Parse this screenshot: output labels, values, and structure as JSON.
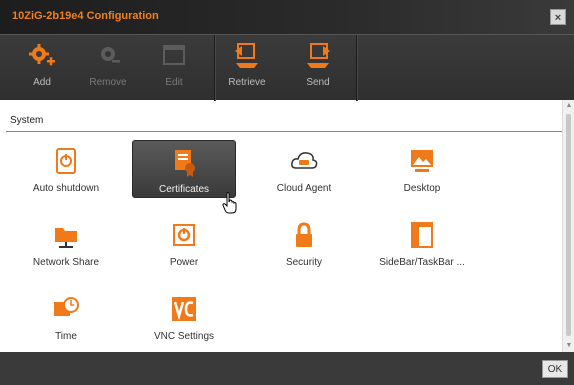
{
  "window": {
    "title": "10ZiG-2b19e4 Configuration",
    "close_glyph": "×"
  },
  "toolbar": {
    "buttons": [
      {
        "label": "Add",
        "icon": "add-gear-icon",
        "enabled": true
      },
      {
        "label": "Remove",
        "icon": "remove-gear-icon",
        "enabled": false
      },
      {
        "label": "Edit",
        "icon": "edit-window-icon",
        "enabled": false
      },
      {
        "label": "Retrieve",
        "icon": "retrieve-icon",
        "enabled": true
      },
      {
        "label": "Send",
        "icon": "send-icon",
        "enabled": true
      }
    ]
  },
  "section": {
    "title": "System"
  },
  "items": [
    {
      "label": "Auto shutdown",
      "icon": "auto-shutdown-icon"
    },
    {
      "label": "Certificates",
      "icon": "certificates-icon",
      "selected": true
    },
    {
      "label": "Cloud Agent",
      "icon": "cloud-agent-icon"
    },
    {
      "label": "Desktop",
      "icon": "desktop-icon"
    },
    {
      "label": "Network Share",
      "icon": "network-share-icon"
    },
    {
      "label": "Power",
      "icon": "power-icon"
    },
    {
      "label": "Security",
      "icon": "lock-icon"
    },
    {
      "label": "SideBar/TaskBar ...",
      "icon": "sidebar-taskbar-icon"
    },
    {
      "label": "Time",
      "icon": "clock-icon"
    },
    {
      "label": "VNC Settings",
      "icon": "vnc-icon"
    }
  ],
  "footer": {
    "ok_label": "OK"
  },
  "colors": {
    "accent": "#f07a1a",
    "titlebar_text": "#f08020",
    "toolbar_bg": "#333333",
    "selected_bg": "#4a4a4a"
  }
}
